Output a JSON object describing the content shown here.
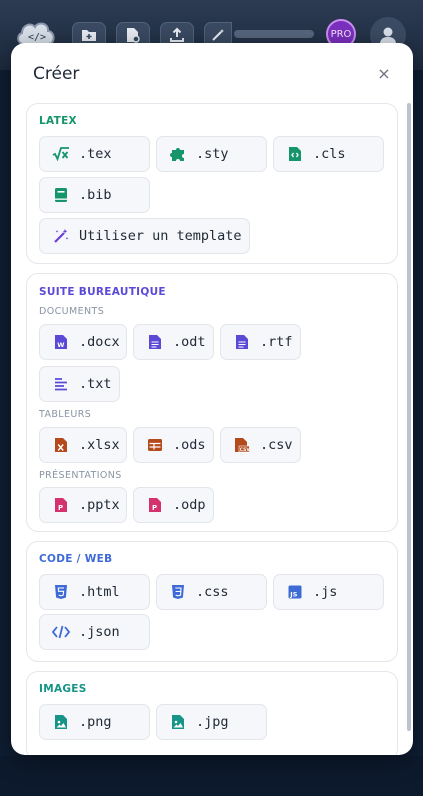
{
  "colors": {
    "latex": "#16956b",
    "office": "#5b4ad6",
    "code": "#3e6ad6",
    "images": "#159487",
    "spreadsheet": "#b4491b",
    "presentation": "#d3326d"
  },
  "topbar": {
    "pro_badge": "PRO"
  },
  "dialog": {
    "title": "Créer",
    "close_label": "×"
  },
  "latex": {
    "title": "LATEX",
    "items": [
      {
        "label": ".tex",
        "icon": "sqrt-x-icon"
      },
      {
        "label": ".sty",
        "icon": "puzzle-icon"
      },
      {
        "label": ".cls",
        "icon": "code-file-icon"
      },
      {
        "label": ".bib",
        "icon": "book-icon"
      },
      {
        "label": "Utiliser un template",
        "icon": "magic-wand-icon"
      }
    ]
  },
  "office": {
    "title": "SUITE BUREAUTIQUE",
    "documents": {
      "title": "DOCUMENTS",
      "items": [
        {
          "label": ".docx",
          "icon": "word-file-icon"
        },
        {
          "label": ".odt",
          "icon": "text-file-icon"
        },
        {
          "label": ".rtf",
          "icon": "text-file-icon"
        },
        {
          "label": ".txt",
          "icon": "text-lines-icon"
        }
      ]
    },
    "spreadsheets": {
      "title": "TABLEURS",
      "items": [
        {
          "label": ".xlsx",
          "icon": "excel-file-icon"
        },
        {
          "label": ".ods",
          "icon": "table-icon"
        },
        {
          "label": ".csv",
          "icon": "csv-file-icon"
        }
      ]
    },
    "presentations": {
      "title": "PRÉSENTATIONS",
      "items": [
        {
          "label": ".pptx",
          "icon": "powerpoint-file-icon"
        },
        {
          "label": ".odp",
          "icon": "powerpoint-file-icon"
        }
      ]
    }
  },
  "code": {
    "title": "CODE / WEB",
    "items": [
      {
        "label": ".html",
        "icon": "html5-icon"
      },
      {
        "label": ".css",
        "icon": "css3-icon"
      },
      {
        "label": ".js",
        "icon": "js-icon"
      },
      {
        "label": ".json",
        "icon": "code-brackets-icon"
      }
    ]
  },
  "images": {
    "title": "IMAGES",
    "items": [
      {
        "label": ".png",
        "icon": "image-file-icon"
      },
      {
        "label": ".jpg",
        "icon": "image-file-icon"
      }
    ]
  }
}
